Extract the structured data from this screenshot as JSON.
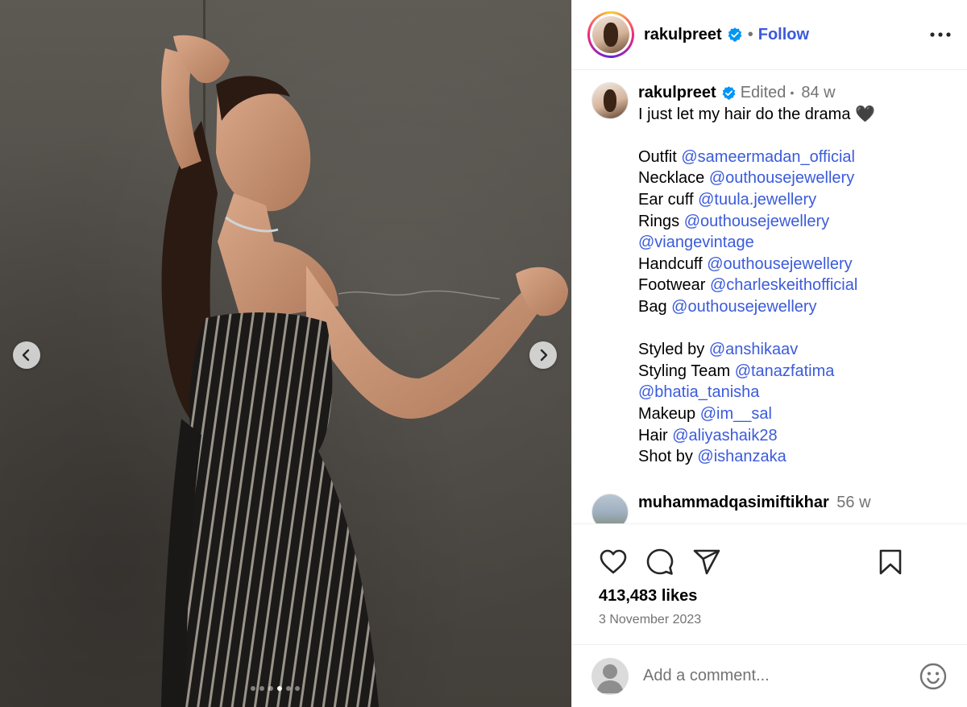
{
  "post": {
    "username": "rakulpreet",
    "follow_label": "Follow",
    "separator": "•"
  },
  "media": {
    "carousel_count": 6,
    "active_index": 3
  },
  "caption": {
    "username": "rakulpreet",
    "edited": "Edited",
    "time": "84 w",
    "lines": [
      {
        "parts": [
          {
            "t": "I just let my hair do the drama 🖤",
            "m": false
          }
        ]
      },
      {
        "parts": []
      },
      {
        "parts": [
          {
            "t": "Outfit ",
            "m": false
          },
          {
            "t": "@sameermadan_official",
            "m": true
          }
        ]
      },
      {
        "parts": [
          {
            "t": "Necklace ",
            "m": false
          },
          {
            "t": "@outhousejewellery",
            "m": true
          }
        ]
      },
      {
        "parts": [
          {
            "t": "Ear cuff ",
            "m": false
          },
          {
            "t": "@tuula.jewellery",
            "m": true
          }
        ]
      },
      {
        "parts": [
          {
            "t": "Rings ",
            "m": false
          },
          {
            "t": "@outhousejewellery",
            "m": true
          }
        ]
      },
      {
        "parts": [
          {
            "t": "@viangevintage",
            "m": true
          }
        ]
      },
      {
        "parts": [
          {
            "t": "Handcuff ",
            "m": false
          },
          {
            "t": "@outhousejewellery",
            "m": true
          }
        ]
      },
      {
        "parts": [
          {
            "t": "Footwear ",
            "m": false
          },
          {
            "t": "@charleskeithofficial",
            "m": true
          }
        ]
      },
      {
        "parts": [
          {
            "t": "Bag ",
            "m": false
          },
          {
            "t": "@outhousejewellery",
            "m": true
          }
        ]
      },
      {
        "parts": []
      },
      {
        "parts": [
          {
            "t": "Styled by ",
            "m": false
          },
          {
            "t": "@anshikaav",
            "m": true
          }
        ]
      },
      {
        "parts": [
          {
            "t": "Styling Team ",
            "m": false
          },
          {
            "t": "@tanazfatima",
            "m": true
          }
        ]
      },
      {
        "parts": [
          {
            "t": "@bhatia_tanisha",
            "m": true
          }
        ]
      },
      {
        "parts": [
          {
            "t": "Makeup ",
            "m": false
          },
          {
            "t": "@im__sal",
            "m": true
          }
        ]
      },
      {
        "parts": [
          {
            "t": "Hair ",
            "m": false
          },
          {
            "t": "@aliyashaik28",
            "m": true
          }
        ]
      },
      {
        "parts": [
          {
            "t": "Shot by ",
            "m": false
          },
          {
            "t": "@ishanzaka",
            "m": true
          }
        ]
      }
    ]
  },
  "comments": [
    {
      "username": "muhammadqasimiftikhar",
      "time": "56 w"
    }
  ],
  "engagement": {
    "likes": "413,483 likes",
    "date": "3 November 2023"
  },
  "comment_box": {
    "placeholder": "Add a comment..."
  },
  "icons": {
    "verified": "verified-badge-icon",
    "more": "more-options-icon",
    "like": "heart-icon",
    "comment": "comment-icon",
    "share": "share-icon",
    "save": "bookmark-icon",
    "emoji": "emoji-icon",
    "prev": "chevron-left-icon",
    "next": "chevron-right-icon"
  },
  "colors": {
    "mention": "#3b5bdb",
    "follow": "#3b5bdb",
    "verified": "#0095f6",
    "muted": "#737373"
  }
}
